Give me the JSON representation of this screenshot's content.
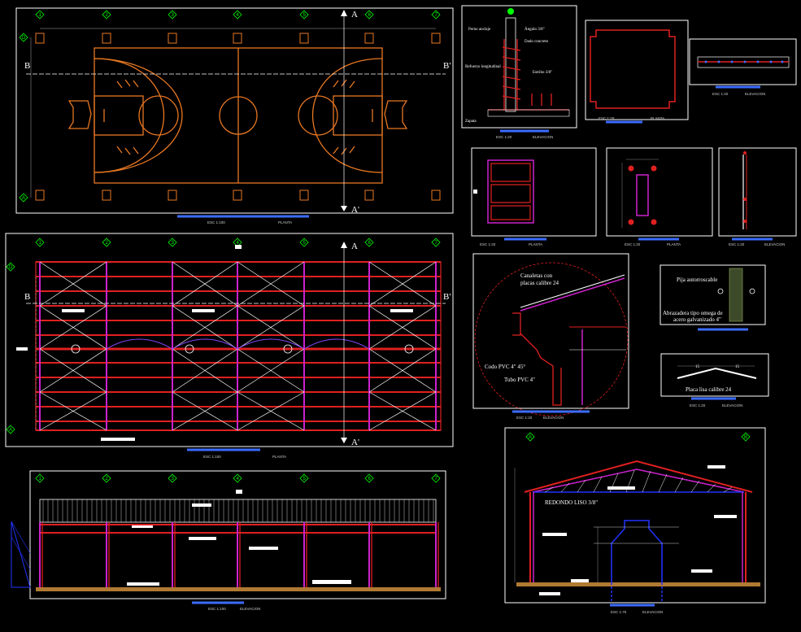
{
  "colors": {
    "background": "#000000",
    "frame": "#ffffff",
    "court": "#e87722",
    "truss": "#e02020",
    "column": "#cc22cc",
    "bracing": "#ffffff",
    "grid_marker": "#00ff00",
    "title_link": "#3b6cff",
    "blue": "#2233ff"
  },
  "grid_axes_numbers": [
    "1",
    "2",
    "3",
    "4",
    "5",
    "6",
    "7"
  ],
  "grid_axes_letters": [
    "D",
    "A"
  ],
  "section_marks": {
    "a": "A",
    "a_prime": "A'",
    "b": "B",
    "b_prime": "B'",
    "col_a": "A",
    "col_b": "B"
  },
  "court_plan": {
    "scale": "ESC 1:100",
    "view": "PLANTA"
  },
  "roof_plan": {
    "scale": "ESC 1:100",
    "view": "PLANTA"
  },
  "side_elevation": {
    "scale": "ESC 1:100",
    "view": "ELEVACION"
  },
  "cross_section": {
    "scale": "ESC 1:75",
    "view": "ELEVACION",
    "note": "REDONDO LISO 3/8\""
  },
  "column_base": {
    "scale": "ESC 1:20",
    "view": "ELEVACION",
    "labels": [
      "Perno anclaje",
      "Ángulo 3/8\"",
      "Dado concreto",
      "Refuerzo longitudinal",
      "Estribo 3/8\"",
      "Zapata"
    ]
  },
  "base_plate": {
    "scale": "ESC 1:20",
    "view": "PLANTA"
  },
  "purlin": {
    "scale": "ESC 1:20",
    "view": "ELEVACION"
  },
  "stirrup_plan": {
    "scale": "ESC 1:20",
    "view": "PLANTA"
  },
  "anchor_plan": {
    "scale": "ESC 1:20",
    "view": "PLANTA"
  },
  "anchor_elev": {
    "scale": "ESC 1:20",
    "view": "ELEVACION"
  },
  "gutter_detail": {
    "scale": "ESC 1:20",
    "view": "ELEVACION",
    "label_1": "Canaletas con",
    "label_1b": "placas calibre 24",
    "label_2": "Codo PVC 4\" 45°",
    "label_3": "Tubo PVC 4\""
  },
  "screw_detail": {
    "label_1": "Pija autorroscable",
    "label_2": "Abrazadera tipo omega de",
    "label_3": "acero galvanizado 4\""
  },
  "ridge_detail": {
    "dim_left": "15",
    "dim_right": "15",
    "label": "Placa lisa calibre 24",
    "scale": "ESC 1:20",
    "view": "ELEVACION"
  }
}
